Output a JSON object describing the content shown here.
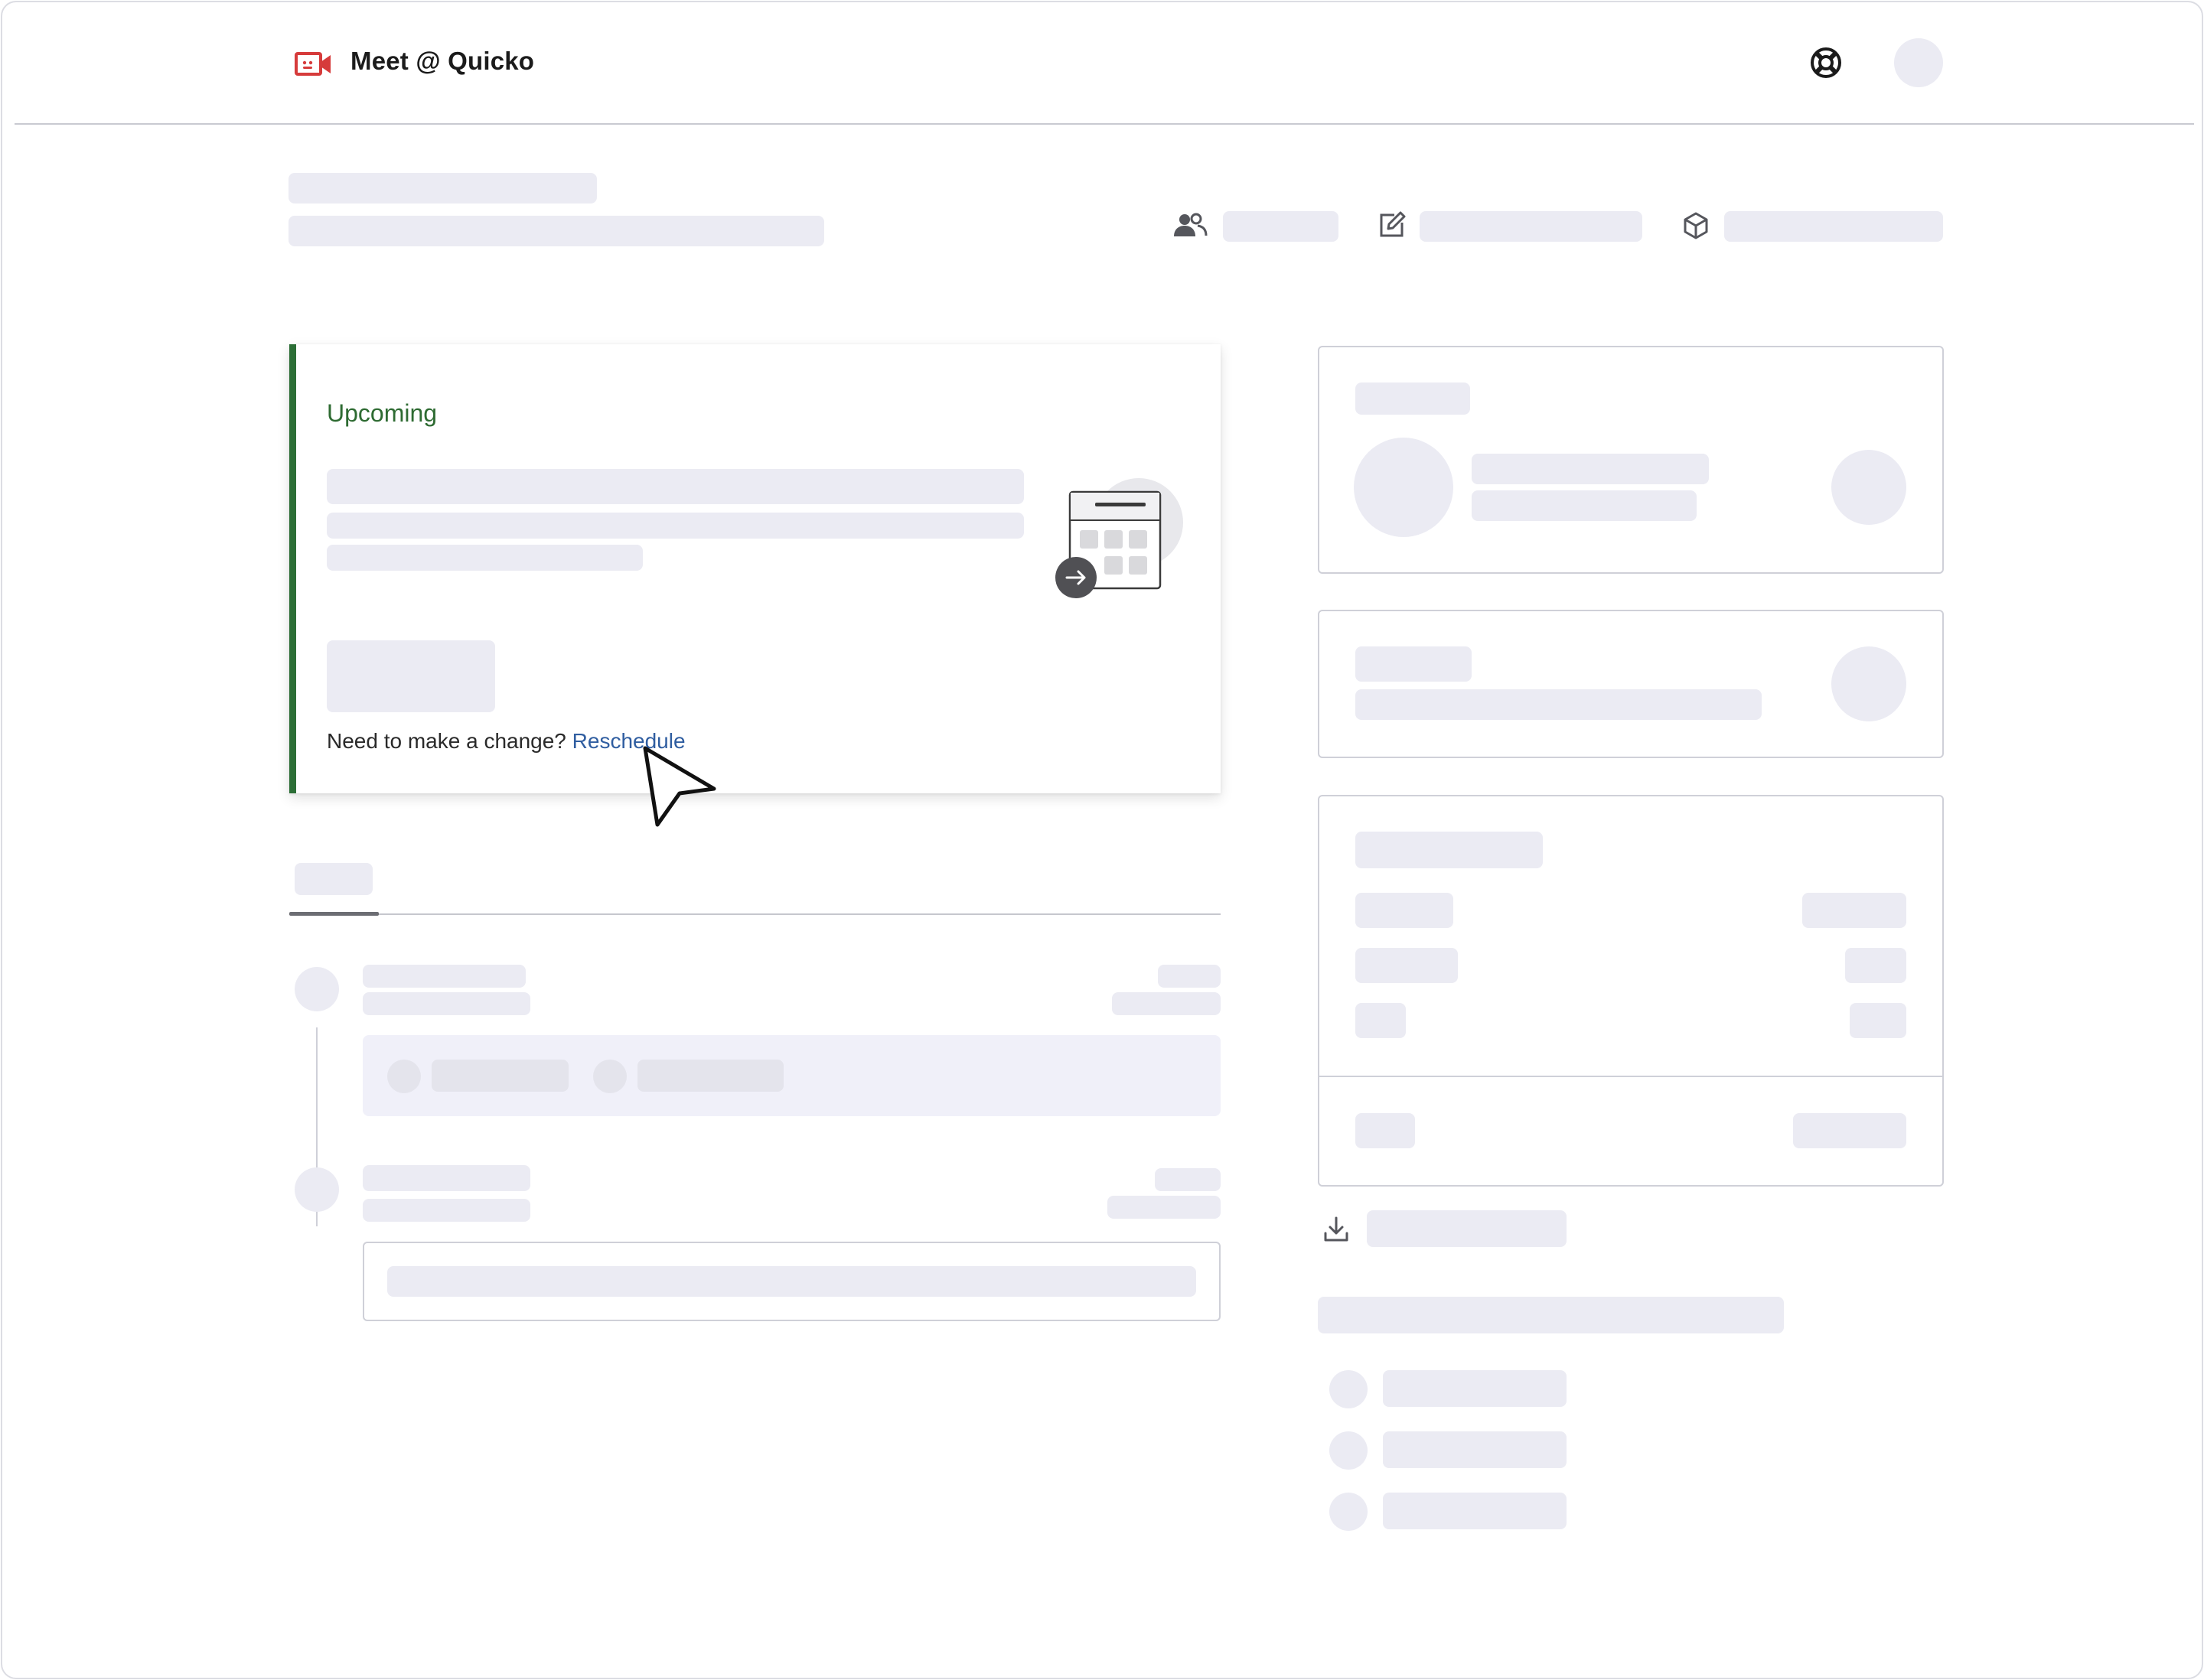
{
  "header": {
    "app_title": "Meet @ Quicko",
    "help_icon": "lifebuoy-icon",
    "avatar": "avatar"
  },
  "colors": {
    "brand": "#d63b3b",
    "status": "#2e6b32",
    "link": "#2f5da0",
    "skeleton": "#ebebf3"
  },
  "meta_icons": [
    "people-icon",
    "edit-icon",
    "cube-icon"
  ],
  "upcoming_card": {
    "status": "Upcoming",
    "change_prompt": "Need to make a change?",
    "reschedule_link": "Reschedule",
    "illustration": "calendar-illustration"
  },
  "sidebar": {
    "download_icon": "download-icon"
  }
}
